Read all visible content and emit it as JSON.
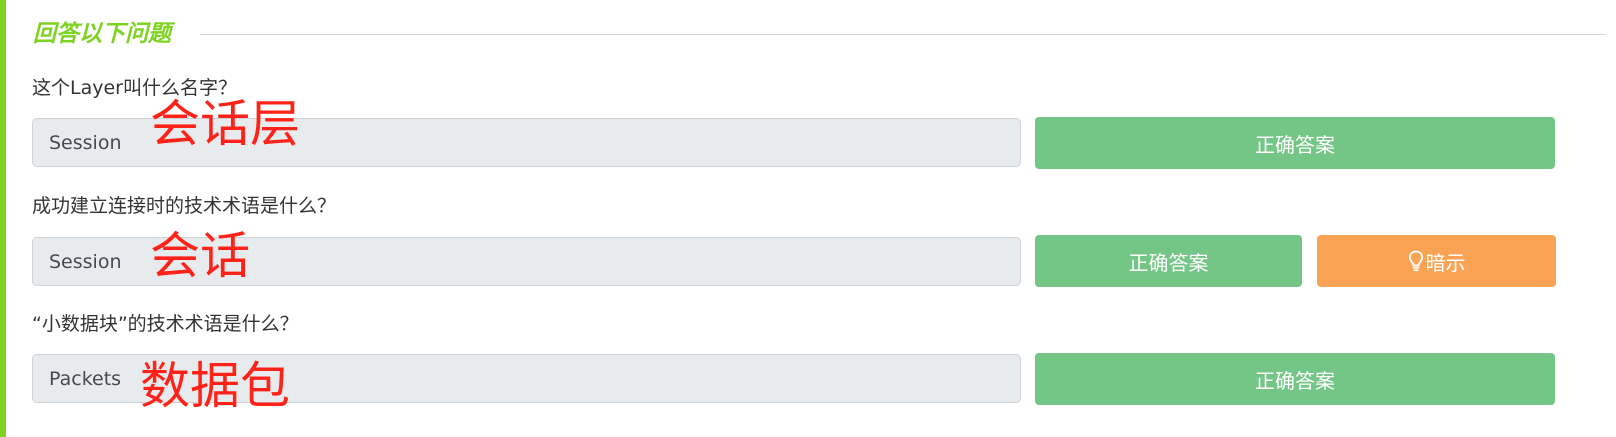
{
  "colors": {
    "accent": "#7ed321",
    "correct_button": "#74c686",
    "hint_button": "#fba354",
    "input_bg": "#e8ebee",
    "annotation": "#ff2218"
  },
  "section": {
    "title": "回答以下问题"
  },
  "questions": [
    {
      "text": "这个Layer叫什么名字？",
      "answer_value": "Session",
      "correct_label": "正确答案",
      "annotation": "会话层"
    },
    {
      "text": "成功建立连接时的技术术语是什么？",
      "answer_value": "Session",
      "correct_label": "正确答案",
      "hint_label": "暗示",
      "hint_icon": "lightbulb-icon",
      "annotation": "会话"
    },
    {
      "text": "“小数据块”的技术术语是什么？",
      "answer_value": "Packets",
      "correct_label": "正确答案",
      "annotation": "数据包"
    }
  ]
}
